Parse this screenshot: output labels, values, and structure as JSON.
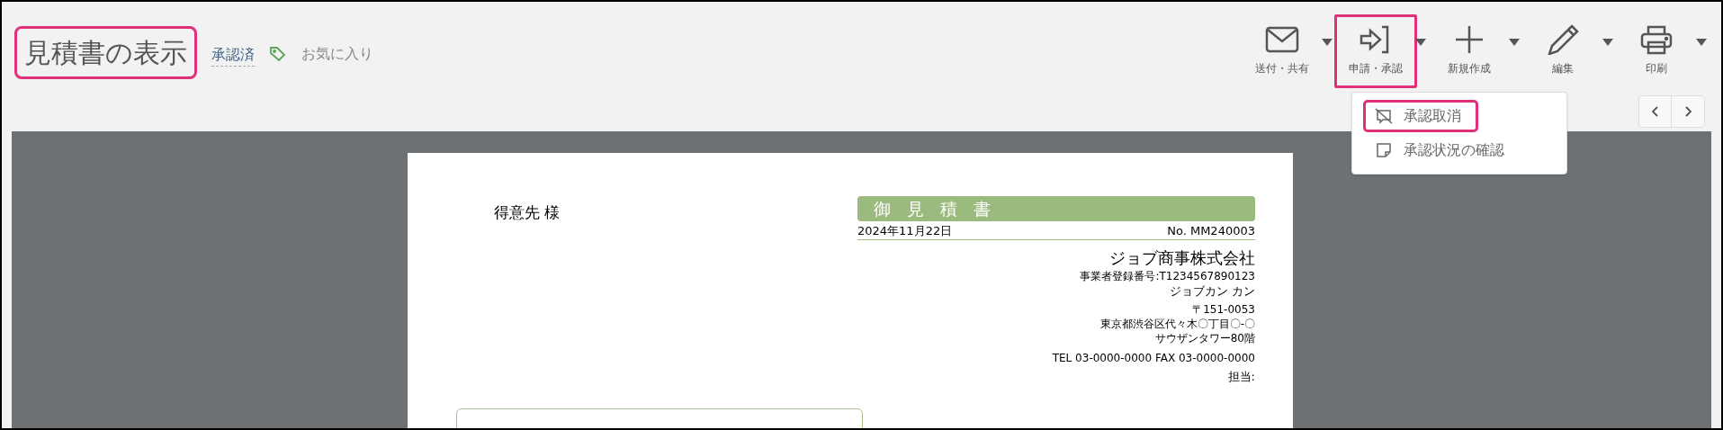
{
  "header": {
    "title": "見積書の表示",
    "title_highlighted": true,
    "status": "承認済",
    "favorite": {
      "label": "お気に入り"
    }
  },
  "actions": [
    {
      "kind": "mail",
      "label": "送付・共有",
      "highlighted": false
    },
    {
      "kind": "apply",
      "label": "申請・承認",
      "highlighted": true
    },
    {
      "kind": "new",
      "label": "新規作成",
      "highlighted": false
    },
    {
      "kind": "edit",
      "label": "編集",
      "highlighted": false
    },
    {
      "kind": "print",
      "label": "印刷",
      "highlighted": false
    }
  ],
  "dropdown": [
    {
      "kind": "cancel",
      "label": "承認取消",
      "highlighted": true
    },
    {
      "kind": "status",
      "label": "承認状況の確認",
      "highlighted": false
    }
  ],
  "document": {
    "customer": "得意先 様",
    "title": "御 見 積 書",
    "date": "2024年11月22日",
    "number": "No. MM240003",
    "company": "ジョブ商事株式会社",
    "registration": "事業者登録番号:T1234567890123",
    "person": "ジョブカン カン",
    "postal": "〒151-0053",
    "address": "東京都渋谷区代々木〇丁目〇-〇",
    "building": "サウザンタワー80階",
    "phone": "TEL 03-0000-0000 FAX 03-0000-0000",
    "staff": "担当:"
  }
}
